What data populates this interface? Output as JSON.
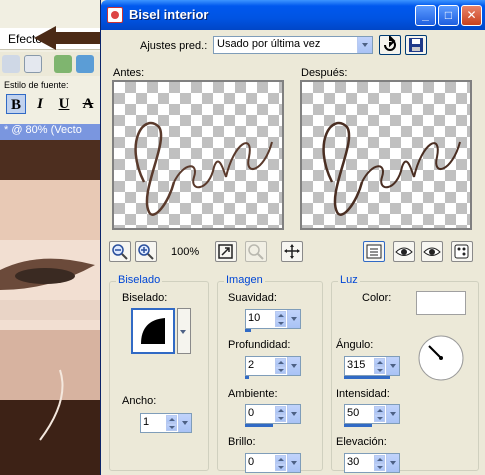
{
  "background_app": {
    "menu_efectos": "Efecto",
    "font_style_label": "Estilo de fuente:",
    "font_buttons": [
      "B",
      "I",
      "U",
      "A"
    ],
    "doc_title": "* @ 80% (Vecto"
  },
  "dialog": {
    "title": "Bisel interior",
    "window_buttons": {
      "minimize": "_",
      "maximize": "□",
      "close": "✕"
    },
    "presets_label": "Ajustes pred.:",
    "presets_value": "Usado por última vez",
    "before_label": "Antes:",
    "after_label": "Después:",
    "zoom_percent": "100%",
    "groups": {
      "bevel": {
        "title": "Biselado",
        "bevel_label": "Biselado:",
        "width_label": "Ancho:",
        "width_value": "1"
      },
      "image": {
        "title": "Imagen",
        "smoothness_label": "Suavidad:",
        "smoothness_value": "10",
        "depth_label": "Profundidad:",
        "depth_value": "2",
        "ambient_label": "Ambiente:",
        "ambient_value": "0",
        "brightness_label": "Brillo:",
        "brightness_value": "0"
      },
      "light": {
        "title": "Luz",
        "color_label": "Color:",
        "angle_label": "Ángulo:",
        "angle_value": "315",
        "intensity_label": "Intensidad:",
        "intensity_value": "50",
        "elevation_label": "Elevación:",
        "elevation_value": "30"
      }
    }
  }
}
